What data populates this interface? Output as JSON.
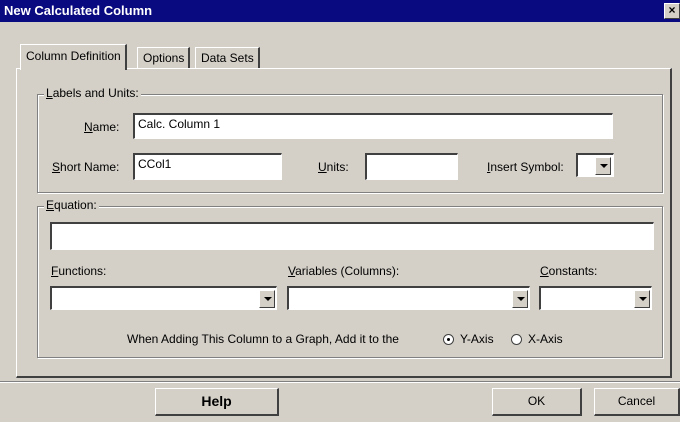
{
  "window": {
    "title": "New Calculated Column",
    "close_glyph": "×"
  },
  "tabs": [
    {
      "label": "Column Definition",
      "active": true
    },
    {
      "label": "Options",
      "active": false
    },
    {
      "label": "Data Sets",
      "active": false
    }
  ],
  "labels_group": {
    "legend_u": "L",
    "legend_rest": "abels and Units:",
    "name_label_u": "N",
    "name_label_rest": "ame:",
    "name_value": "Calc. Column 1",
    "short_name_label_u": "S",
    "short_name_label_rest": "hort Name:",
    "short_name_value": "CCol1",
    "units_label_u": "U",
    "units_label_rest": "nits:",
    "units_value": "",
    "insert_symbol_label_u": "I",
    "insert_symbol_label_rest": "nsert Symbol:",
    "insert_symbol_value": ""
  },
  "equation_group": {
    "legend_u": "E",
    "legend_rest": "quation:",
    "equation_value": "",
    "functions_label_u": "F",
    "functions_label_rest": "unctions:",
    "functions_value": "",
    "variables_label_u": "V",
    "variables_label_rest": "ariables (Columns):",
    "variables_value": "",
    "constants_label_u": "C",
    "constants_label_rest": "onstants:",
    "constants_value": ""
  },
  "axis": {
    "prompt": "When Adding This Column to a Graph, Add it to the",
    "options": [
      {
        "label": "Y-Axis",
        "checked": true
      },
      {
        "label": "X-Axis",
        "checked": false
      }
    ]
  },
  "buttons": {
    "help": "Help",
    "ok": "OK",
    "cancel": "Cancel"
  }
}
